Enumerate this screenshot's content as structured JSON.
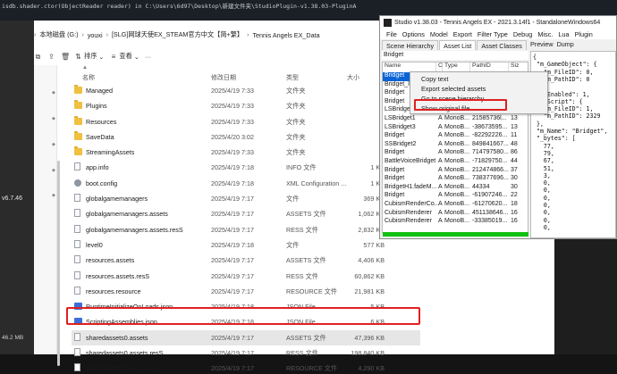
{
  "background": {
    "terminal_text": "isdb.shader.ctor(ObjectReader reader) in C:\\Users\\6d97\\Desktop\\新建文件夹\\StudioPlugin-v1.38.03-PluginA",
    "left_text": "v6.7.46",
    "colors": {
      "terminal_bg": "#1b1f26",
      "taskbar_bg": "#141414"
    }
  },
  "explorer": {
    "breadcrumb": [
      "本地磁盘 (G:)",
      "youxi",
      "[SLG]网球天使EX_STEAM官方中文【简+繁】",
      "Tennis Angels EX_Data"
    ],
    "toolbar": {
      "sort_label": "排序",
      "view_label": "查看",
      "more_label": "···"
    },
    "columns": {
      "name": "名称",
      "date": "修改日期",
      "type": "类型",
      "size": "大小"
    },
    "rows": [
      {
        "name": "Managed",
        "date": "2025/4/19 7:33",
        "type": "文件夹",
        "size": "",
        "icon": "folder"
      },
      {
        "name": "Plugins",
        "date": "2025/4/19 7:33",
        "type": "文件夹",
        "size": "",
        "icon": "folder"
      },
      {
        "name": "Resources",
        "date": "2025/4/19 7:33",
        "type": "文件夹",
        "size": "",
        "icon": "folder"
      },
      {
        "name": "SaveData",
        "date": "2025/4/20 3:02",
        "type": "文件夹",
        "size": "",
        "icon": "folder"
      },
      {
        "name": "StreamingAssets",
        "date": "2025/4/19 7:33",
        "type": "文件夹",
        "size": "",
        "icon": "folder"
      },
      {
        "name": "app.info",
        "date": "2025/4/19 7:18",
        "type": "INFO 文件",
        "size": "1 KB",
        "icon": "file"
      },
      {
        "name": "boot.config",
        "date": "2025/4/19 7:18",
        "type": "XML Configuration ...",
        "size": "1 KB",
        "icon": "gear"
      },
      {
        "name": "globalgamemanagers",
        "date": "2025/4/19 7:17",
        "type": "文件",
        "size": "369 KB",
        "icon": "file"
      },
      {
        "name": "globalgamemanagers.assets",
        "date": "2025/4/19 7:17",
        "type": "ASSETS 文件",
        "size": "1,062 KB",
        "icon": "file"
      },
      {
        "name": "globalgamemanagers.assets.resS",
        "date": "2025/4/19 7:17",
        "type": "RESS 文件",
        "size": "2,832 KB",
        "icon": "file"
      },
      {
        "name": "level0",
        "date": "2025/4/19 7:18",
        "type": "文件",
        "size": "577 KB",
        "icon": "file"
      },
      {
        "name": "resources.assets",
        "date": "2025/4/19 7:17",
        "type": "ASSETS 文件",
        "size": "4,406 KB",
        "icon": "file"
      },
      {
        "name": "resources.assets.resS",
        "date": "2025/4/19 7:17",
        "type": "RESS 文件",
        "size": "60,862 KB",
        "icon": "file"
      },
      {
        "name": "resources.resource",
        "date": "2025/4/19 7:17",
        "type": "RESOURCE 文件",
        "size": "21,981 KB",
        "icon": "file"
      },
      {
        "name": "RuntimeInitializeOnLoads.json",
        "date": "2025/4/19 7:18",
        "type": "JSON File",
        "size": "5 KB",
        "icon": "app"
      },
      {
        "name": "ScriptingAssemblies.json",
        "date": "2025/4/19 7:18",
        "type": "JSON File",
        "size": "6 KB",
        "icon": "app"
      },
      {
        "name": "sharedassets0.assets",
        "date": "2025/4/19 7:17",
        "type": "ASSETS 文件",
        "size": "47,396 KB",
        "icon": "file"
      },
      {
        "name": "sharedassets0.assets.resS",
        "date": "2025/4/19 7:17",
        "type": "RESS 文件",
        "size": "198,840 KB",
        "icon": "file"
      },
      {
        "name": "sharedassets0.resource",
        "date": "2025/4/19 7:17",
        "type": "RESOURCE 文件",
        "size": "4,290 KB",
        "icon": "file"
      }
    ],
    "selected_row_index": 16,
    "status_size": "46.2 MB"
  },
  "studio": {
    "title": "Studio v1.38.03 - Tennis Angels EX - 2021.3.14f1 - StandaloneWindows64",
    "menu": [
      "File",
      "Options",
      "Model",
      "Export",
      "Filter Type",
      "Debug",
      "Misc.",
      "Lua",
      "Plugin"
    ],
    "tabs": [
      "Scene Hierarchy",
      "Asset List",
      "Asset Classes"
    ],
    "active_tab": "Asset List",
    "filter_text": "Bridget",
    "list_columns": [
      "Name",
      "C",
      "Type",
      "PathID",
      "Siz"
    ],
    "list_rows": [
      {
        "name": "Bridget",
        "c": "",
        "type": "",
        "pathid": "",
        "size": "",
        "selected": true
      },
      {
        "name": "Bridget_I",
        "c": "",
        "type": "",
        "pathid": "",
        "size": ""
      },
      {
        "name": "Bridget",
        "c": "",
        "type": "",
        "pathid": "",
        "size": ""
      },
      {
        "name": "Bridget",
        "c": "",
        "type": "",
        "pathid": "",
        "size": ""
      },
      {
        "name": "LSBridget",
        "c": "",
        "type": "",
        "pathid": "",
        "size": ""
      },
      {
        "name": "LSBridget1",
        "c": "A",
        "type": "MonoB...",
        "pathid": "21585736l...",
        "size": "13"
      },
      {
        "name": "LSBridget3",
        "c": "A",
        "type": "MonoB...",
        "pathid": "-38673595...",
        "size": "13"
      },
      {
        "name": "Bridget",
        "c": "A",
        "type": "MonoB...",
        "pathid": "-82292226...",
        "size": "11"
      },
      {
        "name": "SSBridget2",
        "c": "A",
        "type": "MonoB...",
        "pathid": "849841667...",
        "size": "48"
      },
      {
        "name": "Bridget",
        "c": "A",
        "type": "MonoB...",
        "pathid": "714797580...",
        "size": "86"
      },
      {
        "name": "BattleVoiceBridget",
        "c": "A",
        "type": "MonoB...",
        "pathid": "-71829750...",
        "size": "44"
      },
      {
        "name": "Bridget",
        "c": "A",
        "type": "MonoB...",
        "pathid": "212474866...",
        "size": "37"
      },
      {
        "name": "Bridget",
        "c": "A",
        "type": "MonoB...",
        "pathid": "738377696...",
        "size": "30"
      },
      {
        "name": "BridgetH1.fadeM...",
        "c": "A",
        "type": "MonoB...",
        "pathid": "44334",
        "size": "30"
      },
      {
        "name": "Bridget",
        "c": "A",
        "type": "MonoB...",
        "pathid": "-61907246...",
        "size": "22"
      },
      {
        "name": "CubismRenderCo...",
        "c": "A",
        "type": "MonoB...",
        "pathid": "-61270620...",
        "size": "18"
      },
      {
        "name": "CubismRenderer",
        "c": "A",
        "type": "MonoB...",
        "pathid": "451138646...",
        "size": "16"
      },
      {
        "name": "CubismRenderer",
        "c": "A",
        "type": "MonoB...",
        "pathid": "-33385019...",
        "size": "16"
      }
    ],
    "right_tabs": [
      "Preview",
      "Dump"
    ],
    "dump_lines": [
      "{",
      " \"m_GameObject\": {",
      "   \"m_FileID\": 0,",
      "   \"m_PathID\": 0",
      " },",
      " \"m_Enabled\": 1,",
      " \"m_Script\": {",
      "   \"m_FileID\": 1,",
      "   \"m_PathID\": 2329",
      " },",
      " \"m_Name\": \"Bridget\",",
      " \"_bytes\": [",
      "   77,",
      "   79,",
      "   67,",
      "   51,",
      "   3,",
      "   0,",
      "   0,",
      "   0,",
      "   0,",
      "   0,",
      "   0,",
      "   0,"
    ],
    "context_menu": [
      "Copy text",
      "Export selected assets",
      "Go to scene hierarchy",
      "Show original file"
    ],
    "progress": 1.0,
    "colors": {
      "selection": "#0a64d6",
      "progress": "#12c012",
      "highlight": "#e02020"
    }
  }
}
